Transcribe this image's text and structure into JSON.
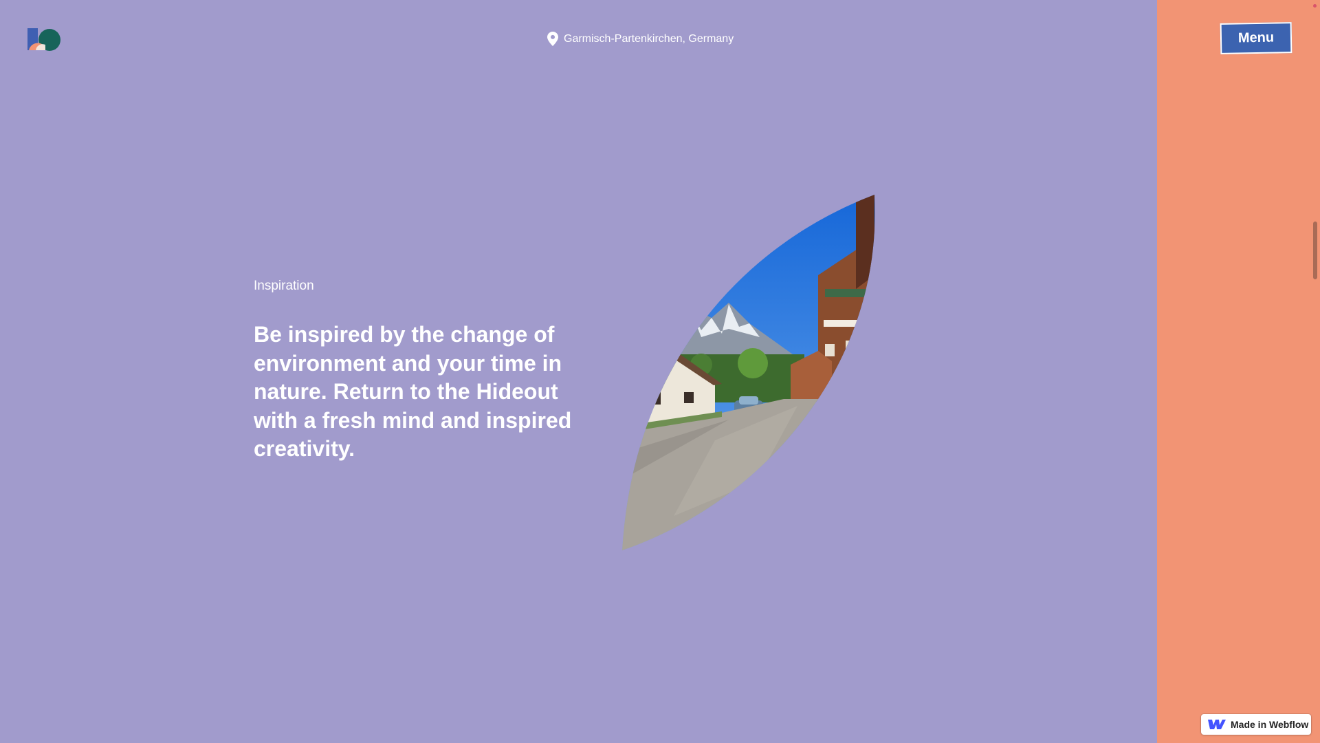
{
  "header": {
    "logo_icon": "brand-logo-icon",
    "location_icon": "map-pin-icon",
    "location": "Garmisch-Partenkirchen, Germany",
    "menu_label": "Menu"
  },
  "hero": {
    "section_label": "Inspiration",
    "headline": "Be inspired by the change of environment and your time in nature. Return to the Hideout with a fresh mind and inspired creativity.",
    "image_alt": "Alpine village street with mountains"
  },
  "badge": {
    "icon": "webflow-logo-icon",
    "label": "Made in Webflow"
  },
  "colors": {
    "background": "#a19bcc",
    "side_panel": "#f29474",
    "menu_button": "#3c63b0",
    "text": "#ffffff"
  }
}
